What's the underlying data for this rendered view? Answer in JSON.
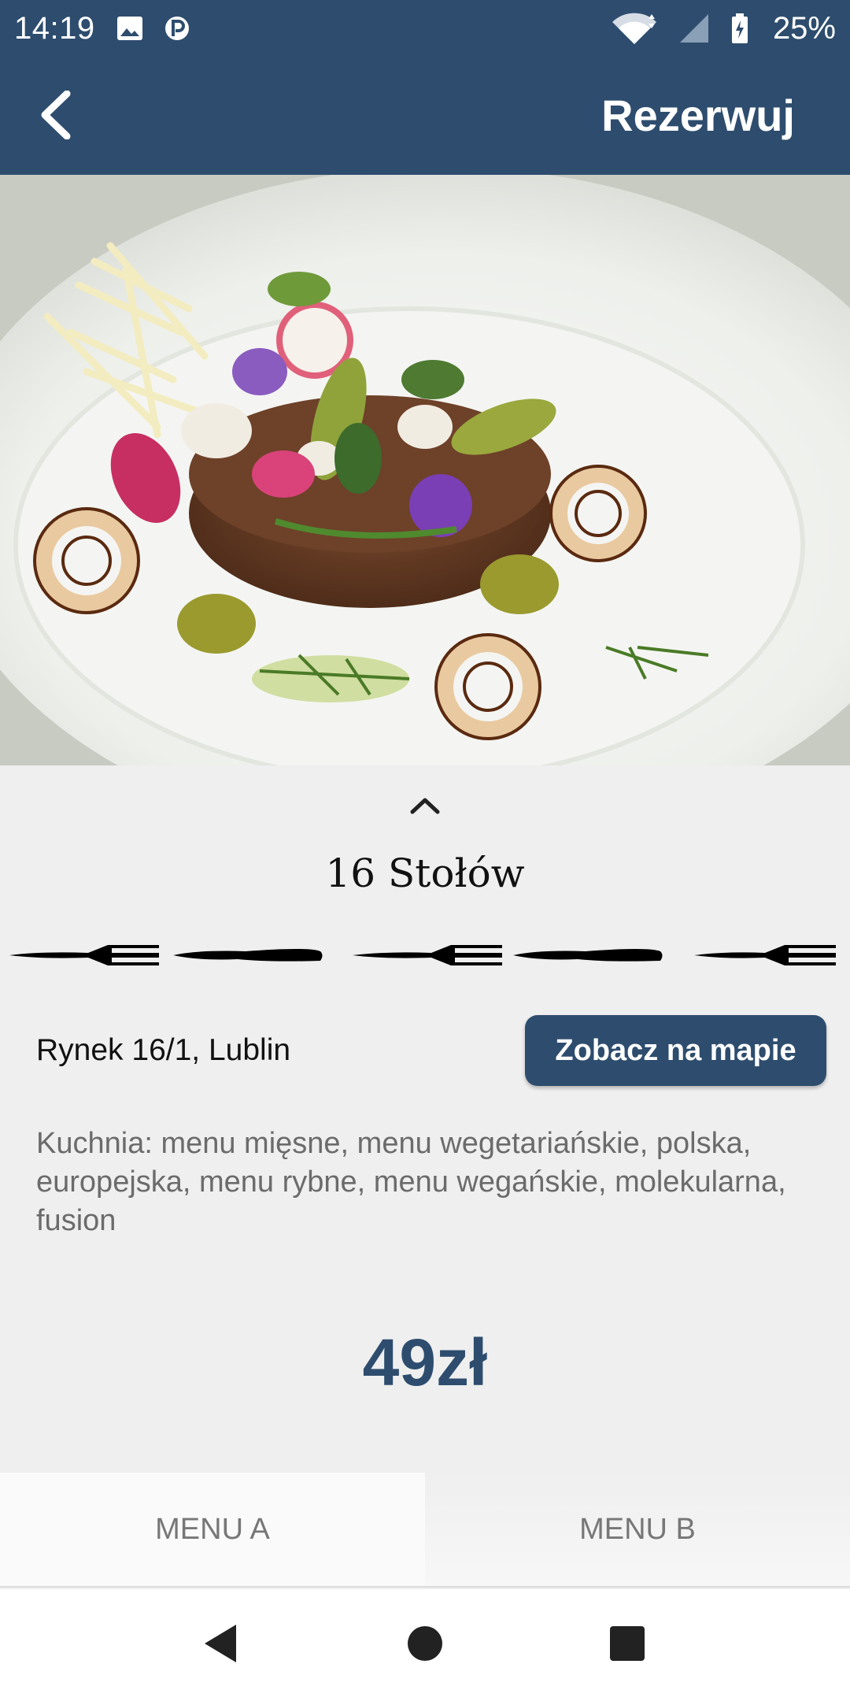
{
  "status_bar": {
    "time": "14:19",
    "battery": "25%",
    "icons": [
      "image-icon",
      "parking-icon",
      "wifi-icon",
      "signal-icon",
      "battery-charging-icon"
    ]
  },
  "app_bar": {
    "back_icon": "chevron-left-icon",
    "action_label": "Rezerwuj"
  },
  "hero": {
    "image": "food-dish-photo"
  },
  "restaurant": {
    "toggle_icon": "chevron-up-icon",
    "name": "16 Stołów",
    "rating_icons": [
      "fork-icon",
      "knife-icon",
      "fork-icon",
      "knife-icon",
      "fork-icon"
    ],
    "address": "Rynek 16/1, Lublin",
    "map_button_label": "Zobacz na mapie",
    "cuisine": "Kuchnia: menu mięsne, menu wegetariańskie, polska, europejska, menu rybne, menu wegańskie, molekularna, fusion",
    "price": "49zł"
  },
  "tabs": [
    {
      "label": "MENU A",
      "selected": true
    },
    {
      "label": "MENU B",
      "selected": false
    }
  ],
  "nav_bar": {
    "icons": [
      "back-triangle-icon",
      "home-circle-icon",
      "recents-square-icon"
    ]
  },
  "colors": {
    "primary": "#2e4d6e",
    "background": "#efefef",
    "muted_text": "#6b6b6b"
  }
}
